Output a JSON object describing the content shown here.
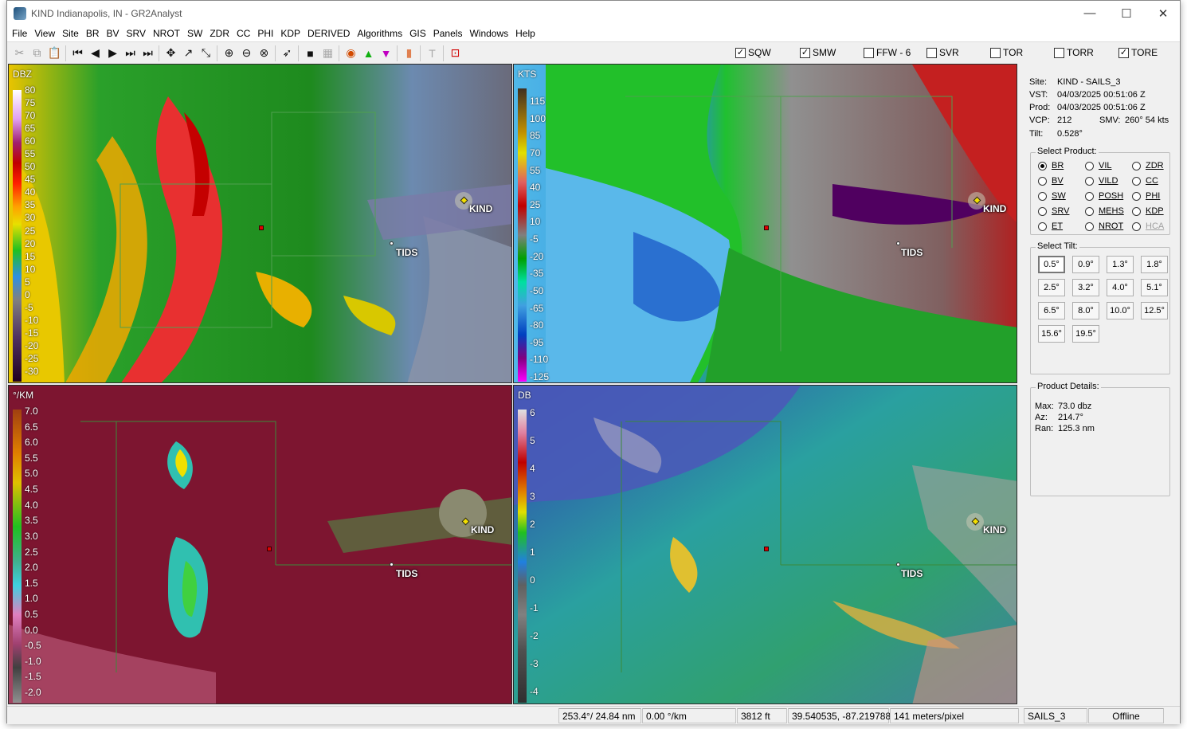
{
  "window": {
    "title": "KIND Indianapolis, IN - GR2Analyst",
    "minimize": "—",
    "maximize": "☐",
    "close": "✕"
  },
  "menu": [
    "File",
    "View",
    "Site",
    "BR",
    "BV",
    "SRV",
    "NROT",
    "SW",
    "ZDR",
    "CC",
    "PHI",
    "KDP",
    "DERIVED",
    "Algorithms",
    "GIS",
    "Panels",
    "Windows",
    "Help"
  ],
  "warnings": [
    {
      "label": "SQW",
      "checked": true
    },
    {
      "label": "SMW",
      "checked": true
    },
    {
      "label": "FFW - 6",
      "checked": false
    },
    {
      "label": "SVR",
      "checked": false
    },
    {
      "label": "TOR",
      "checked": false
    },
    {
      "label": "TORR",
      "checked": false
    },
    {
      "label": "TORE",
      "checked": true
    }
  ],
  "panels": [
    {
      "unit": "DBZ",
      "ticks": [
        "80",
        "75",
        "70",
        "65",
        "60",
        "55",
        "50",
        "45",
        "40",
        "35",
        "30",
        "25",
        "20",
        "15",
        "10",
        "5",
        "0",
        "-5",
        "-10",
        "-15",
        "-20",
        "-25",
        "-30"
      ]
    },
    {
      "unit": "KTS",
      "ticks": [
        "115",
        "100",
        "85",
        "70",
        "55",
        "40",
        "25",
        "10",
        "-5",
        "-20",
        "-35",
        "-50",
        "-65",
        "-80",
        "-95",
        "-110",
        "-125"
      ]
    },
    {
      "unit": "°/KM",
      "ticks": [
        "7.0",
        "6.5",
        "6.0",
        "5.5",
        "5.0",
        "4.5",
        "4.0",
        "3.5",
        "3.0",
        "2.5",
        "2.0",
        "1.5",
        "1.0",
        "0.5",
        "0.0",
        "-0.5",
        "-1.0",
        "-1.5",
        "-2.0"
      ]
    },
    {
      "unit": "DB",
      "ticks": [
        "6",
        "5",
        "4",
        "3",
        "2",
        "1",
        "0",
        "-1",
        "-2",
        "-3",
        "-4"
      ]
    }
  ],
  "places": {
    "site": "KIND",
    "tids": "TIDS"
  },
  "info": {
    "site_label": "Site:",
    "site": "KIND - SAILS_3",
    "vst_label": "VST:",
    "vst": "04/03/2025  00:51:06 Z",
    "prod_label": "Prod:",
    "prod": "04/03/2025  00:51:06 Z",
    "vcp_label": "VCP:",
    "vcp": "212",
    "smv_label": "SMV:",
    "smv": "260° 54 kts",
    "tilt_label": "Tilt:",
    "tilt": "0.528°"
  },
  "select_product": {
    "label": "Select Product:",
    "items": [
      {
        "label": "BR",
        "selected": true,
        "enabled": true
      },
      {
        "label": "VIL",
        "selected": false,
        "enabled": true
      },
      {
        "label": "ZDR",
        "selected": false,
        "enabled": true
      },
      {
        "label": "BV",
        "selected": false,
        "enabled": true
      },
      {
        "label": "VILD",
        "selected": false,
        "enabled": true
      },
      {
        "label": "CC",
        "selected": false,
        "enabled": true
      },
      {
        "label": "SW",
        "selected": false,
        "enabled": true
      },
      {
        "label": "POSH",
        "selected": false,
        "enabled": true
      },
      {
        "label": "PHI",
        "selected": false,
        "enabled": true
      },
      {
        "label": "SRV",
        "selected": false,
        "enabled": true
      },
      {
        "label": "MEHS",
        "selected": false,
        "enabled": true
      },
      {
        "label": "KDP",
        "selected": false,
        "enabled": true
      },
      {
        "label": "ET",
        "selected": false,
        "enabled": true
      },
      {
        "label": "NROT",
        "selected": false,
        "enabled": true
      },
      {
        "label": "HCA",
        "selected": false,
        "enabled": false
      }
    ]
  },
  "select_tilt": {
    "label": "Select Tilt:",
    "items": [
      "0.5°",
      "0.9°",
      "1.3°",
      "1.8°",
      "2.5°",
      "3.2°",
      "4.0°",
      "5.1°",
      "6.5°",
      "8.0°",
      "10.0°",
      "12.5°",
      "15.6°",
      "19.5°"
    ],
    "selected": "0.5°"
  },
  "product_details": {
    "label": "Product Details:",
    "max_label": "Max:",
    "max": "73.0 dbz",
    "az_label": "Az:",
    "az": "214.7°",
    "ran_label": "Ran:",
    "ran": "125.3 nm"
  },
  "status": {
    "azrange": "253.4°/ 24.84 nm",
    "rot": "0.00 °/km",
    "height": "3812 ft",
    "coords": "39.540535, -87.219788",
    "scale": "141 meters/pixel",
    "sails": "SAILS_3",
    "mode": "Offline"
  }
}
